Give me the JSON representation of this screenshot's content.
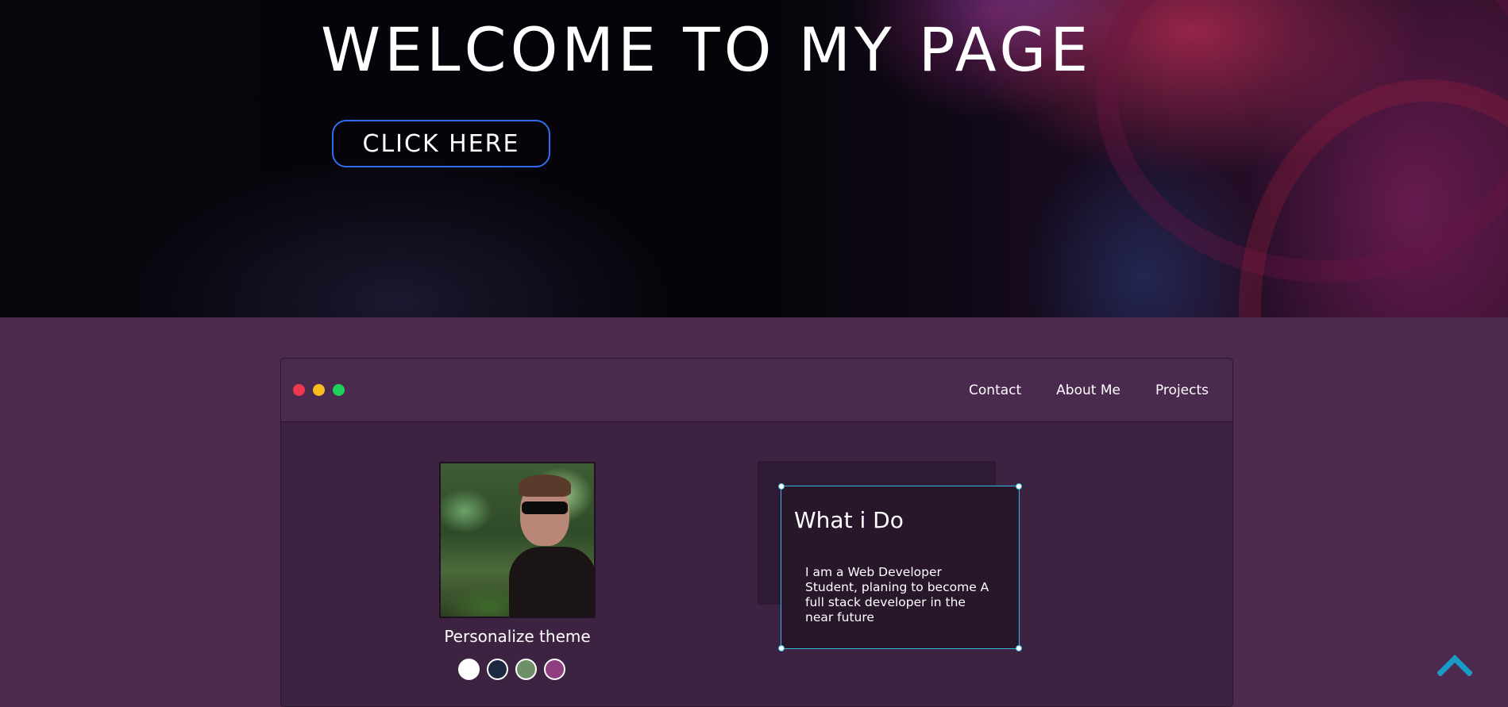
{
  "hero": {
    "title": "WELCOME TO MY PAGE",
    "button_label": "CLICK HERE"
  },
  "window": {
    "nav": [
      {
        "label": "Contact"
      },
      {
        "label": "About Me"
      },
      {
        "label": "Projects"
      }
    ],
    "theme_label": "Personalize theme",
    "theme_swatches": [
      "#ffffff",
      "#1d2940",
      "#6f8f69",
      "#8f3f80"
    ],
    "card": {
      "title": "What i Do",
      "text": "I am a Web Developer Student, planing to become A full stack developer in the near future"
    }
  },
  "icons": {
    "scroll_top": "chevron-up-icon",
    "window_controls": [
      "close-dot",
      "minimize-dot",
      "maximize-dot"
    ]
  },
  "colors": {
    "accent_blue": "#2f6df0",
    "chevron": "#1a9cc8",
    "card_border": "#37b8e0",
    "page_bg": "#4c2a4f"
  }
}
